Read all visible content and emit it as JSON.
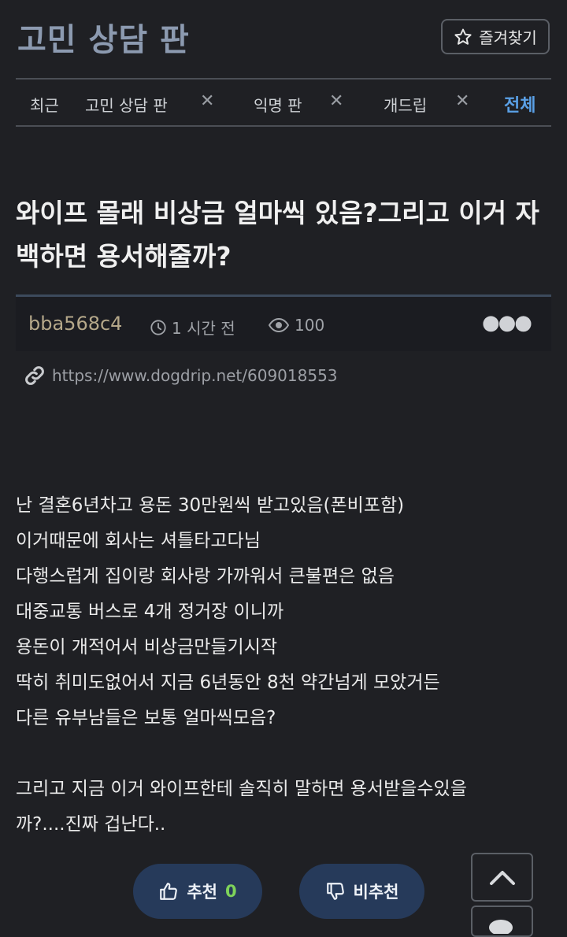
{
  "header": {
    "board_title": "고민 상담 판",
    "favorite_label": "즐겨찾기"
  },
  "tabs": [
    {
      "label": "최근"
    },
    {
      "label": "고민 상담 판"
    },
    {
      "label": "익명 판"
    },
    {
      "label": "개드립"
    },
    {
      "label": "전체"
    }
  ],
  "post": {
    "title": "와이프 몰래 비상금 얼마씩 있음?그리고 이거 자백하면 용서해줄까?",
    "author": "bba568c4",
    "time": "1 시간 전",
    "views": "100",
    "url": "https://www.dogdrip.net/609018553",
    "lines": [
      "난 결혼6년차고 용돈 30만원씩 받고있음(폰비포함)",
      "이거때문에 회사는 셔틀타고다님",
      "다행스럽게 집이랑 회사랑 가까워서 큰불편은 없음",
      "대중교통 버스로 4개 정거장 이니까",
      "용돈이 개적어서 비상금만들기시작",
      "딱히 취미도없어서 지금 6년동안 8천 약간넘게 모았거든",
      "다른 유부남들은 보통 얼마씩모음?",
      "",
      "그리고 지금 이거 와이프한테 솔직히 말하면 용서받을수있을",
      "까?....진짜 겁난다.."
    ]
  },
  "votes": {
    "up_label": "추천",
    "up_count": "0",
    "down_label": "비추천"
  },
  "icons": [
    "star-icon",
    "close-icon",
    "clock-icon",
    "eye-icon",
    "more-icon",
    "link-icon",
    "thumbs-up-icon",
    "thumbs-down-icon",
    "chevron-up-icon",
    "comment-icon"
  ]
}
